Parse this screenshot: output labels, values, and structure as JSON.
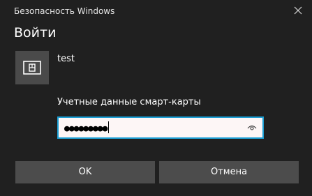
{
  "window": {
    "title": "Безопасность Windows",
    "close_icon": "close-icon"
  },
  "dialog": {
    "heading": "Войти",
    "account": {
      "icon": "smart-card-icon",
      "username": "test"
    },
    "credential_label": "Учетные данные смарт-карты",
    "password": {
      "masked_value": "●●●●●●●●●",
      "reveal_icon": "eye-icon"
    },
    "buttons": {
      "ok_label": "OK",
      "cancel_label": "Отмена"
    }
  },
  "colors": {
    "background": "#202020",
    "button": "#4c4c4c",
    "tile": "#4a4a4a",
    "focus_border": "#1c9fd4",
    "input_bg": "#fdf6f6"
  }
}
